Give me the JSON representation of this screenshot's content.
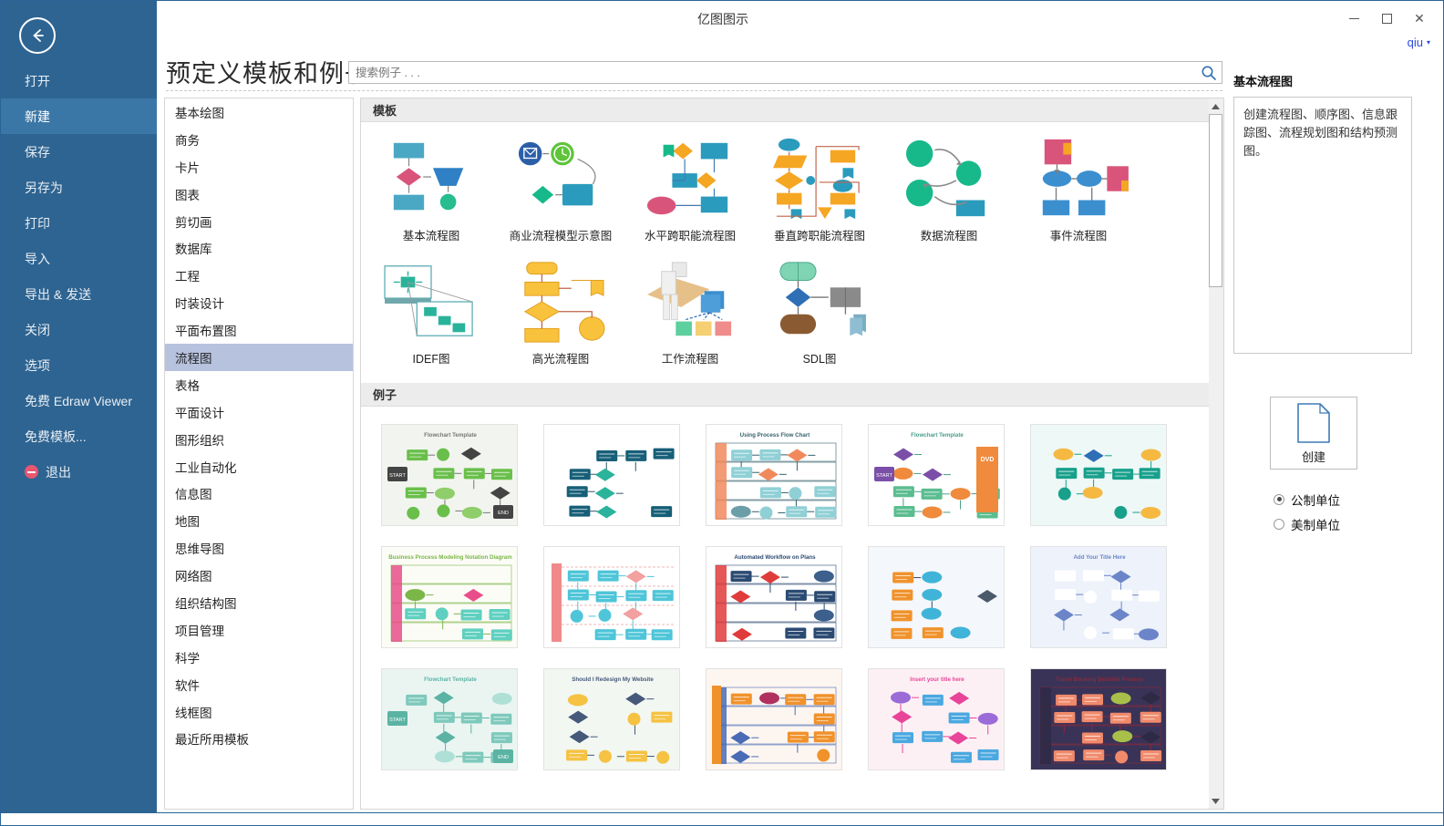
{
  "window": {
    "title": "亿图图示",
    "minimize_label": "minimize",
    "maximize_label": "maximize",
    "close_label": "✕",
    "account": "qiu",
    "account_caret": "▾"
  },
  "sidebar": {
    "back_label": "back",
    "items": [
      {
        "label": "打开",
        "active": false
      },
      {
        "label": "新建",
        "active": true
      },
      {
        "label": "保存",
        "active": false
      },
      {
        "label": "另存为",
        "active": false
      },
      {
        "label": "打印",
        "active": false
      },
      {
        "label": "导入",
        "active": false
      },
      {
        "label": "导出 & 发送",
        "active": false
      },
      {
        "label": "关闭",
        "active": false
      },
      {
        "label": "选项",
        "active": false
      },
      {
        "label": "免费 Edraw Viewer",
        "active": false
      },
      {
        "label": "免费模板...",
        "active": false
      },
      {
        "label": "退出",
        "active": false,
        "icon": "exit-icon"
      }
    ]
  },
  "header": {
    "page_title": "预定义模板和例子"
  },
  "search": {
    "value": "",
    "placeholder": "搜索例子 . . .",
    "icon": "search-icon"
  },
  "categories": {
    "selected": "流程图",
    "items": [
      "基本绘图",
      "商务",
      "卡片",
      "图表",
      "剪切画",
      "数据库",
      "工程",
      "时装设计",
      "平面布置图",
      "流程图",
      "表格",
      "平面设计",
      "图形组织",
      "工业自动化",
      "信息图",
      "地图",
      "思维导图",
      "网络图",
      "组织结构图",
      "项目管理",
      "科学",
      "软件",
      "线框图",
      "最近所用模板"
    ]
  },
  "templates_section": {
    "heading": "模板",
    "items": [
      {
        "label": "基本流程图",
        "thumb": "basic-flowchart"
      },
      {
        "label": "商业流程模型示意图",
        "thumb": "bpmn"
      },
      {
        "label": "水平跨职能流程图",
        "thumb": "horizontal-cross-functional"
      },
      {
        "label": "垂直跨职能流程图",
        "thumb": "vertical-cross-functional"
      },
      {
        "label": "数据流程图",
        "thumb": "data-flow"
      },
      {
        "label": "事件流程图",
        "thumb": "event-flow"
      },
      {
        "label": "IDEF图",
        "thumb": "idef"
      },
      {
        "label": "高光流程图",
        "thumb": "highlight-flowchart"
      },
      {
        "label": "工作流程图",
        "thumb": "workflow"
      },
      {
        "label": "SDL图",
        "thumb": "sdl"
      }
    ]
  },
  "examples_section": {
    "heading": "例子",
    "items": [
      {
        "name": "flowchart-template-green",
        "caption": "Flowchart Template",
        "start": "START",
        "end": "END"
      },
      {
        "name": "teal-decision-flow",
        "caption": ""
      },
      {
        "name": "cross-functional-chart",
        "caption": "Using Process Flow Chart"
      },
      {
        "name": "flowchart-template-dvd",
        "caption": "Flowchart Template",
        "extra": "DVD",
        "start": "START"
      },
      {
        "name": "teal-diamond-network",
        "caption": ""
      },
      {
        "name": "business-process-swimlane",
        "caption": "Business Process Modeling Notation Diagram"
      },
      {
        "name": "pink-lane-flow",
        "caption": ""
      },
      {
        "name": "dark-swimlane-workflow",
        "caption": "Automated Workflow on Plans"
      },
      {
        "name": "vehicle-network-diagram",
        "caption": ""
      },
      {
        "name": "cloud-roadmap",
        "caption": "Add Your Title Here"
      },
      {
        "name": "teal-arrow-flowchart",
        "caption": "Flowchart Template",
        "start": "START",
        "end": "END"
      },
      {
        "name": "website-redesign-flow",
        "caption": "Should I Redesign My Website"
      },
      {
        "name": "orange-lane-bpmn",
        "caption": ""
      },
      {
        "name": "pink-mindmap",
        "caption": "Insert your title here"
      },
      {
        "name": "purple-swimlane-matrix",
        "caption": "Travel Booking Detailed Process"
      }
    ]
  },
  "info_panel": {
    "title": "基本流程图",
    "description": "创建流程图、顺序图、信息跟踪图、流程规划图和结构预测图。"
  },
  "create": {
    "label": "创建",
    "icon": "document-icon"
  },
  "units": {
    "options": [
      {
        "label": "公制单位",
        "selected": true
      },
      {
        "label": "美制单位",
        "selected": false
      }
    ]
  },
  "colors": {
    "sidebar_bg": "#2e6491",
    "sidebar_active": "#3b77a6",
    "category_active": "#b6c2de",
    "section_header_bg": "#ececec",
    "accent_link": "#2b4bd8",
    "window_border": "#2a6496"
  }
}
